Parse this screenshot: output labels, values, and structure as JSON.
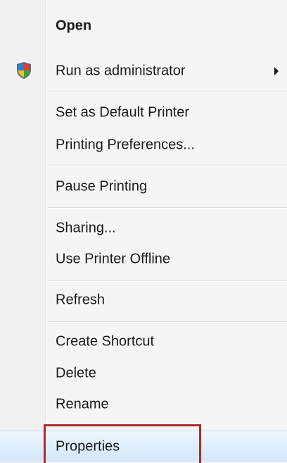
{
  "menu": {
    "items": [
      {
        "label": "Open",
        "bold": true
      },
      {
        "label": "Run as administrator",
        "icon": "uac-shield-icon",
        "submenu": true
      },
      {
        "label": "Set as Default Printer"
      },
      {
        "label": "Printing Preferences..."
      },
      {
        "label": "Pause Printing"
      },
      {
        "label": "Sharing..."
      },
      {
        "label": "Use Printer Offline"
      },
      {
        "label": "Refresh"
      },
      {
        "label": "Create Shortcut"
      },
      {
        "label": "Delete"
      },
      {
        "label": "Rename"
      },
      {
        "label": "Properties",
        "highlighted": true
      }
    ]
  },
  "colors": {
    "highlight_box": "#b02a30",
    "hover_background": "#ddeefb"
  }
}
